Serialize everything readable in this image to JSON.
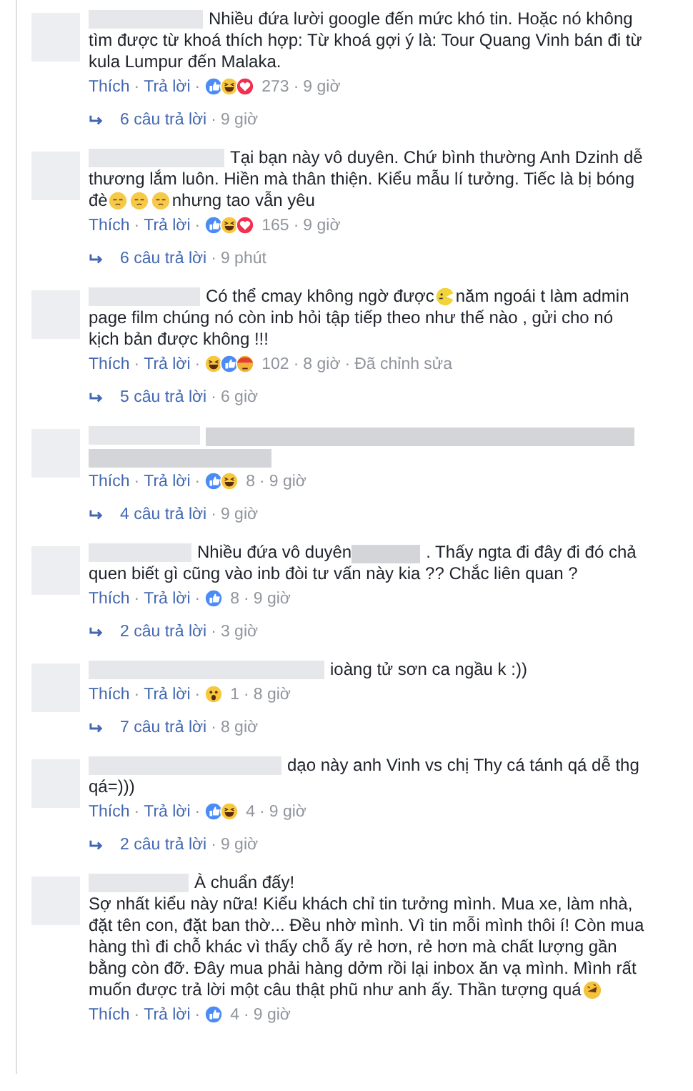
{
  "separator": "·",
  "comments": [
    {
      "lines": [
        [
          {
            "kind": "name-redaction"
          },
          {
            "kind": "text",
            "text": "Nhiều đứa lười google đến mức khó tin. Hoặc nó không"
          }
        ],
        [
          {
            "kind": "text",
            "text": "tìm được từ khoá thích hợp: Từ khoá gợi ý là: Tour Quang Vinh bán đi từ"
          }
        ],
        [
          {
            "kind": "text",
            "text": "kula Lumpur đến Malaka."
          }
        ]
      ],
      "like": "Thích",
      "reply": "Trả lời",
      "reactions": [
        {
          "kind": "like"
        },
        {
          "kind": "haha"
        },
        {
          "kind": "love"
        }
      ],
      "count": "273",
      "time": "9 giờ",
      "replies": {
        "text": "6 câu trả lời",
        "time": "9 giờ"
      }
    },
    {
      "lines": [
        [
          {
            "kind": "name-redaction"
          },
          {
            "kind": "text",
            "text": "Tại bạn này vô duyên. Chứ bình thường Anh Dzinh dễ"
          }
        ],
        [
          {
            "kind": "text",
            "text": "thương lắm luôn. Hiền mà thân thiện. Kiểu mẫu lí tưởng. Tiếc là bị bóng"
          }
        ],
        [
          {
            "kind": "text",
            "text": "đè"
          },
          {
            "kind": "sad-emoji"
          },
          {
            "kind": "sad-emoji"
          },
          {
            "kind": "sad-emoji"
          },
          {
            "kind": "text",
            "text": "nhưng tao vẫn yêu"
          }
        ]
      ],
      "like": "Thích",
      "reply": "Trả lời",
      "reactions": [
        {
          "kind": "like"
        },
        {
          "kind": "haha"
        },
        {
          "kind": "love"
        }
      ],
      "count": "165",
      "time": "9 giờ",
      "replies": {
        "text": "6 câu trả lời",
        "time": "9 phút"
      }
    },
    {
      "lines": [
        [
          {
            "kind": "name-redaction"
          },
          {
            "kind": "text",
            "text": "Có thể cmay không ngờ được"
          },
          {
            "kind": "wink-emoji"
          },
          {
            "kind": "text",
            "text": "năm ngoái t làm admin"
          }
        ],
        [
          {
            "kind": "text",
            "text": "page film chúng nó còn inb hỏi tập tiếp theo như thế nào , gửi cho nó"
          }
        ],
        [
          {
            "kind": "text",
            "text": "kịch bản được không !!!"
          }
        ]
      ],
      "like": "Thích",
      "reply": "Trả lời",
      "reactions": [
        {
          "kind": "haha"
        },
        {
          "kind": "like"
        },
        {
          "kind": "angry"
        }
      ],
      "count": "102",
      "time": "8 giờ",
      "edited": "Đã chỉnh sửa",
      "replies": {
        "text": "5 câu trả lời",
        "time": "6 giờ"
      }
    },
    {
      "lines": [
        [
          {
            "kind": "name-redaction"
          },
          {
            "kind": "line-redaction"
          }
        ],
        [
          {
            "kind": "half-redaction"
          }
        ]
      ],
      "like": "Thích",
      "reply": "Trả lời",
      "reactions": [
        {
          "kind": "like"
        },
        {
          "kind": "haha"
        }
      ],
      "count": "8",
      "time": "9 giờ",
      "replies": {
        "text": "4 câu trả lời",
        "time": "9 giờ"
      }
    },
    {
      "lines": [
        [
          {
            "kind": "name-redaction"
          },
          {
            "kind": "text",
            "text": "Nhiều đứa vô duyên"
          },
          {
            "kind": "inline-redaction"
          },
          {
            "kind": "text",
            "text": ". Thấy ngta đi đây đi đó chả"
          }
        ],
        [
          {
            "kind": "text",
            "text": "quen biết gì cũng vào inb đòi tư vấn này kia ?? Chắc liên quan ?"
          }
        ]
      ],
      "like": "Thích",
      "reply": "Trả lời",
      "reactions": [
        {
          "kind": "like"
        }
      ],
      "count": "8",
      "time": "9 giờ",
      "replies": {
        "text": "2 câu trả lời",
        "time": "3 giờ"
      }
    },
    {
      "lines": [
        [
          {
            "kind": "name-redaction"
          },
          {
            "kind": "text",
            "text": "ioàng tử sơn ca ngầu k :))"
          }
        ]
      ],
      "like": "Thích",
      "reply": "Trả lời",
      "reactions": [
        {
          "kind": "wow"
        }
      ],
      "count": "1",
      "time": "8 giờ",
      "replies": {
        "text": "7 câu trả lời",
        "time": "8 giờ"
      }
    },
    {
      "lines": [
        [
          {
            "kind": "name-redaction"
          },
          {
            "kind": "text",
            "text": "dạo này anh Vinh vs chị Thy cá tánh qá dễ thg"
          }
        ],
        [
          {
            "kind": "text",
            "text": "qá=)))"
          }
        ]
      ],
      "like": "Thích",
      "reply": "Trả lời",
      "reactions": [
        {
          "kind": "like"
        },
        {
          "kind": "haha"
        }
      ],
      "count": "4",
      "time": "9 giờ",
      "replies": {
        "text": "2 câu trả lời",
        "time": "9 giờ"
      }
    },
    {
      "lines": [
        [
          {
            "kind": "name-redaction"
          },
          {
            "kind": "text",
            "text": "À chuẩn đấy!"
          }
        ],
        [
          {
            "kind": "text",
            "text": "Sợ nhất kiểu này nữa! Kiểu khách chỉ tin tưởng mình. Mua xe, làm nhà,"
          }
        ],
        [
          {
            "kind": "text",
            "text": "đặt tên con, đặt ban thờ... Đều nhờ mình. Vì tin mỗi mình thôi í! Còn mua"
          }
        ],
        [
          {
            "kind": "text",
            "text": "hàng thì đi chỗ khác vì thấy chỗ ấy rẻ hơn, rẻ hơn mà chất lượng gần"
          }
        ],
        [
          {
            "kind": "text",
            "text": "bằng còn đỡ. Đây mua phải hàng dởm rồi lại inbox ăn vạ mình. Mình rất"
          }
        ],
        [
          {
            "kind": "text",
            "text": "muốn được trả lời một câu thật phũ như anh ấy. Thần tượng quá"
          },
          {
            "kind": "rofl-emoji"
          }
        ]
      ],
      "like": "Thích",
      "reply": "Trả lời",
      "reactions": [
        {
          "kind": "like"
        }
      ],
      "count": "4",
      "time": "9 giờ"
    }
  ]
}
